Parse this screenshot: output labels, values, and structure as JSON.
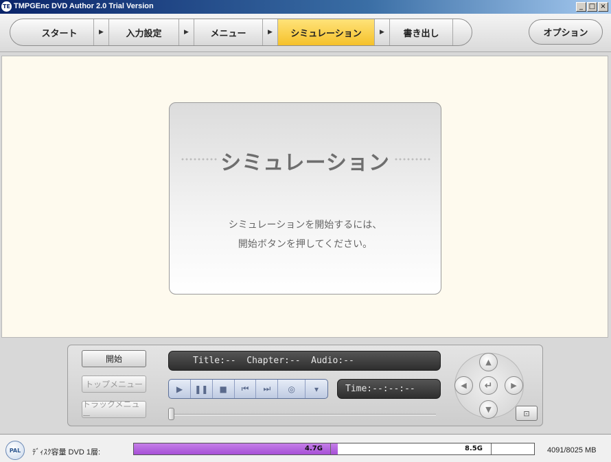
{
  "window": {
    "title": "TMPGEnc DVD Author 2.0 Trial Version",
    "icon_label": "TE",
    "minimize_glyph": "_",
    "maximize_glyph": "□",
    "close_glyph": "×"
  },
  "steps": [
    {
      "label": "スタート",
      "active": false
    },
    {
      "label": "入力設定",
      "active": false
    },
    {
      "label": "メニュー",
      "active": false
    },
    {
      "label": "シミュレーション",
      "active": true
    },
    {
      "label": "書き出し",
      "active": false
    }
  ],
  "step_arrow_glyph": "▶",
  "options_label": "オプション",
  "card": {
    "title": "シミュレーション",
    "message_line1": "シミュレーションを開始するには、",
    "message_line2": "開始ボタンを押してください。"
  },
  "player": {
    "start_label": "開始",
    "top_menu_label": "トップメニュー",
    "track_menu_label": "トラックメニュー",
    "info_display": "Title:--  Chapter:--  Audio:--",
    "time_display": "Time:--:--:--",
    "transport_icons": [
      "play-icon",
      "pause-icon",
      "stop-icon",
      "previous-icon",
      "next-icon",
      "audio-icon",
      "dropdown-arrow-icon"
    ]
  },
  "status": {
    "format_badge": "PAL",
    "label": "ﾃﾞｨｽｸ容量 DVD 1層:",
    "capacity_used_fraction": 0.51,
    "marker_47": "4.7G",
    "marker_85": "8.5G",
    "size_readout": "4091/8025 MB"
  },
  "colors": {
    "active_step": "#f5c12a",
    "capacity_fill": "#a64fd6",
    "main_background": "#fefaee"
  }
}
